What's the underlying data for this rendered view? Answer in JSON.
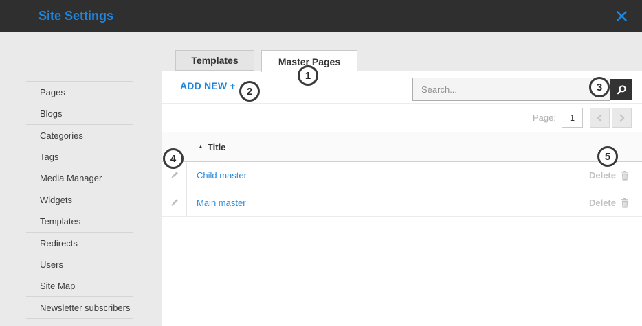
{
  "header": {
    "title": "Site Settings"
  },
  "sidebar": {
    "items": [
      "Pages",
      "Blogs",
      "Categories",
      "Tags",
      "Media Manager",
      "Widgets",
      "Templates",
      "Redirects",
      "Users",
      "Site Map",
      "Newsletter subscribers"
    ]
  },
  "tabs": [
    {
      "label": "Templates",
      "active": false
    },
    {
      "label": "Master Pages",
      "active": true
    }
  ],
  "toolbar": {
    "add_new_label": "ADD NEW +",
    "search_placeholder": "Search...",
    "search_value": ""
  },
  "pagination": {
    "label": "Page:",
    "current_page": "1"
  },
  "table": {
    "sort_indicator": "▲",
    "columns": [
      {
        "label": "Title"
      }
    ],
    "rows": [
      {
        "title": "Child master",
        "delete_label": "Delete"
      },
      {
        "title": "Main master",
        "delete_label": "Delete"
      }
    ]
  },
  "annotations": [
    "1",
    "2",
    "3",
    "4",
    "5"
  ],
  "icons": {
    "close": "close-icon",
    "search": "magnifier-icon",
    "edit": "pencil-icon",
    "delete": "trash-icon",
    "sort": "triangle-up-icon",
    "prev": "chevron-left-icon",
    "next": "chevron-right-icon"
  },
  "colors": {
    "header_bg": "#2f2f2f",
    "accent_blue": "#1e86df",
    "link_blue": "#2b8cdd",
    "body_bg": "#eaeaea",
    "panel_bg": "#ffffff",
    "muted_gray": "#c0c0c0"
  }
}
